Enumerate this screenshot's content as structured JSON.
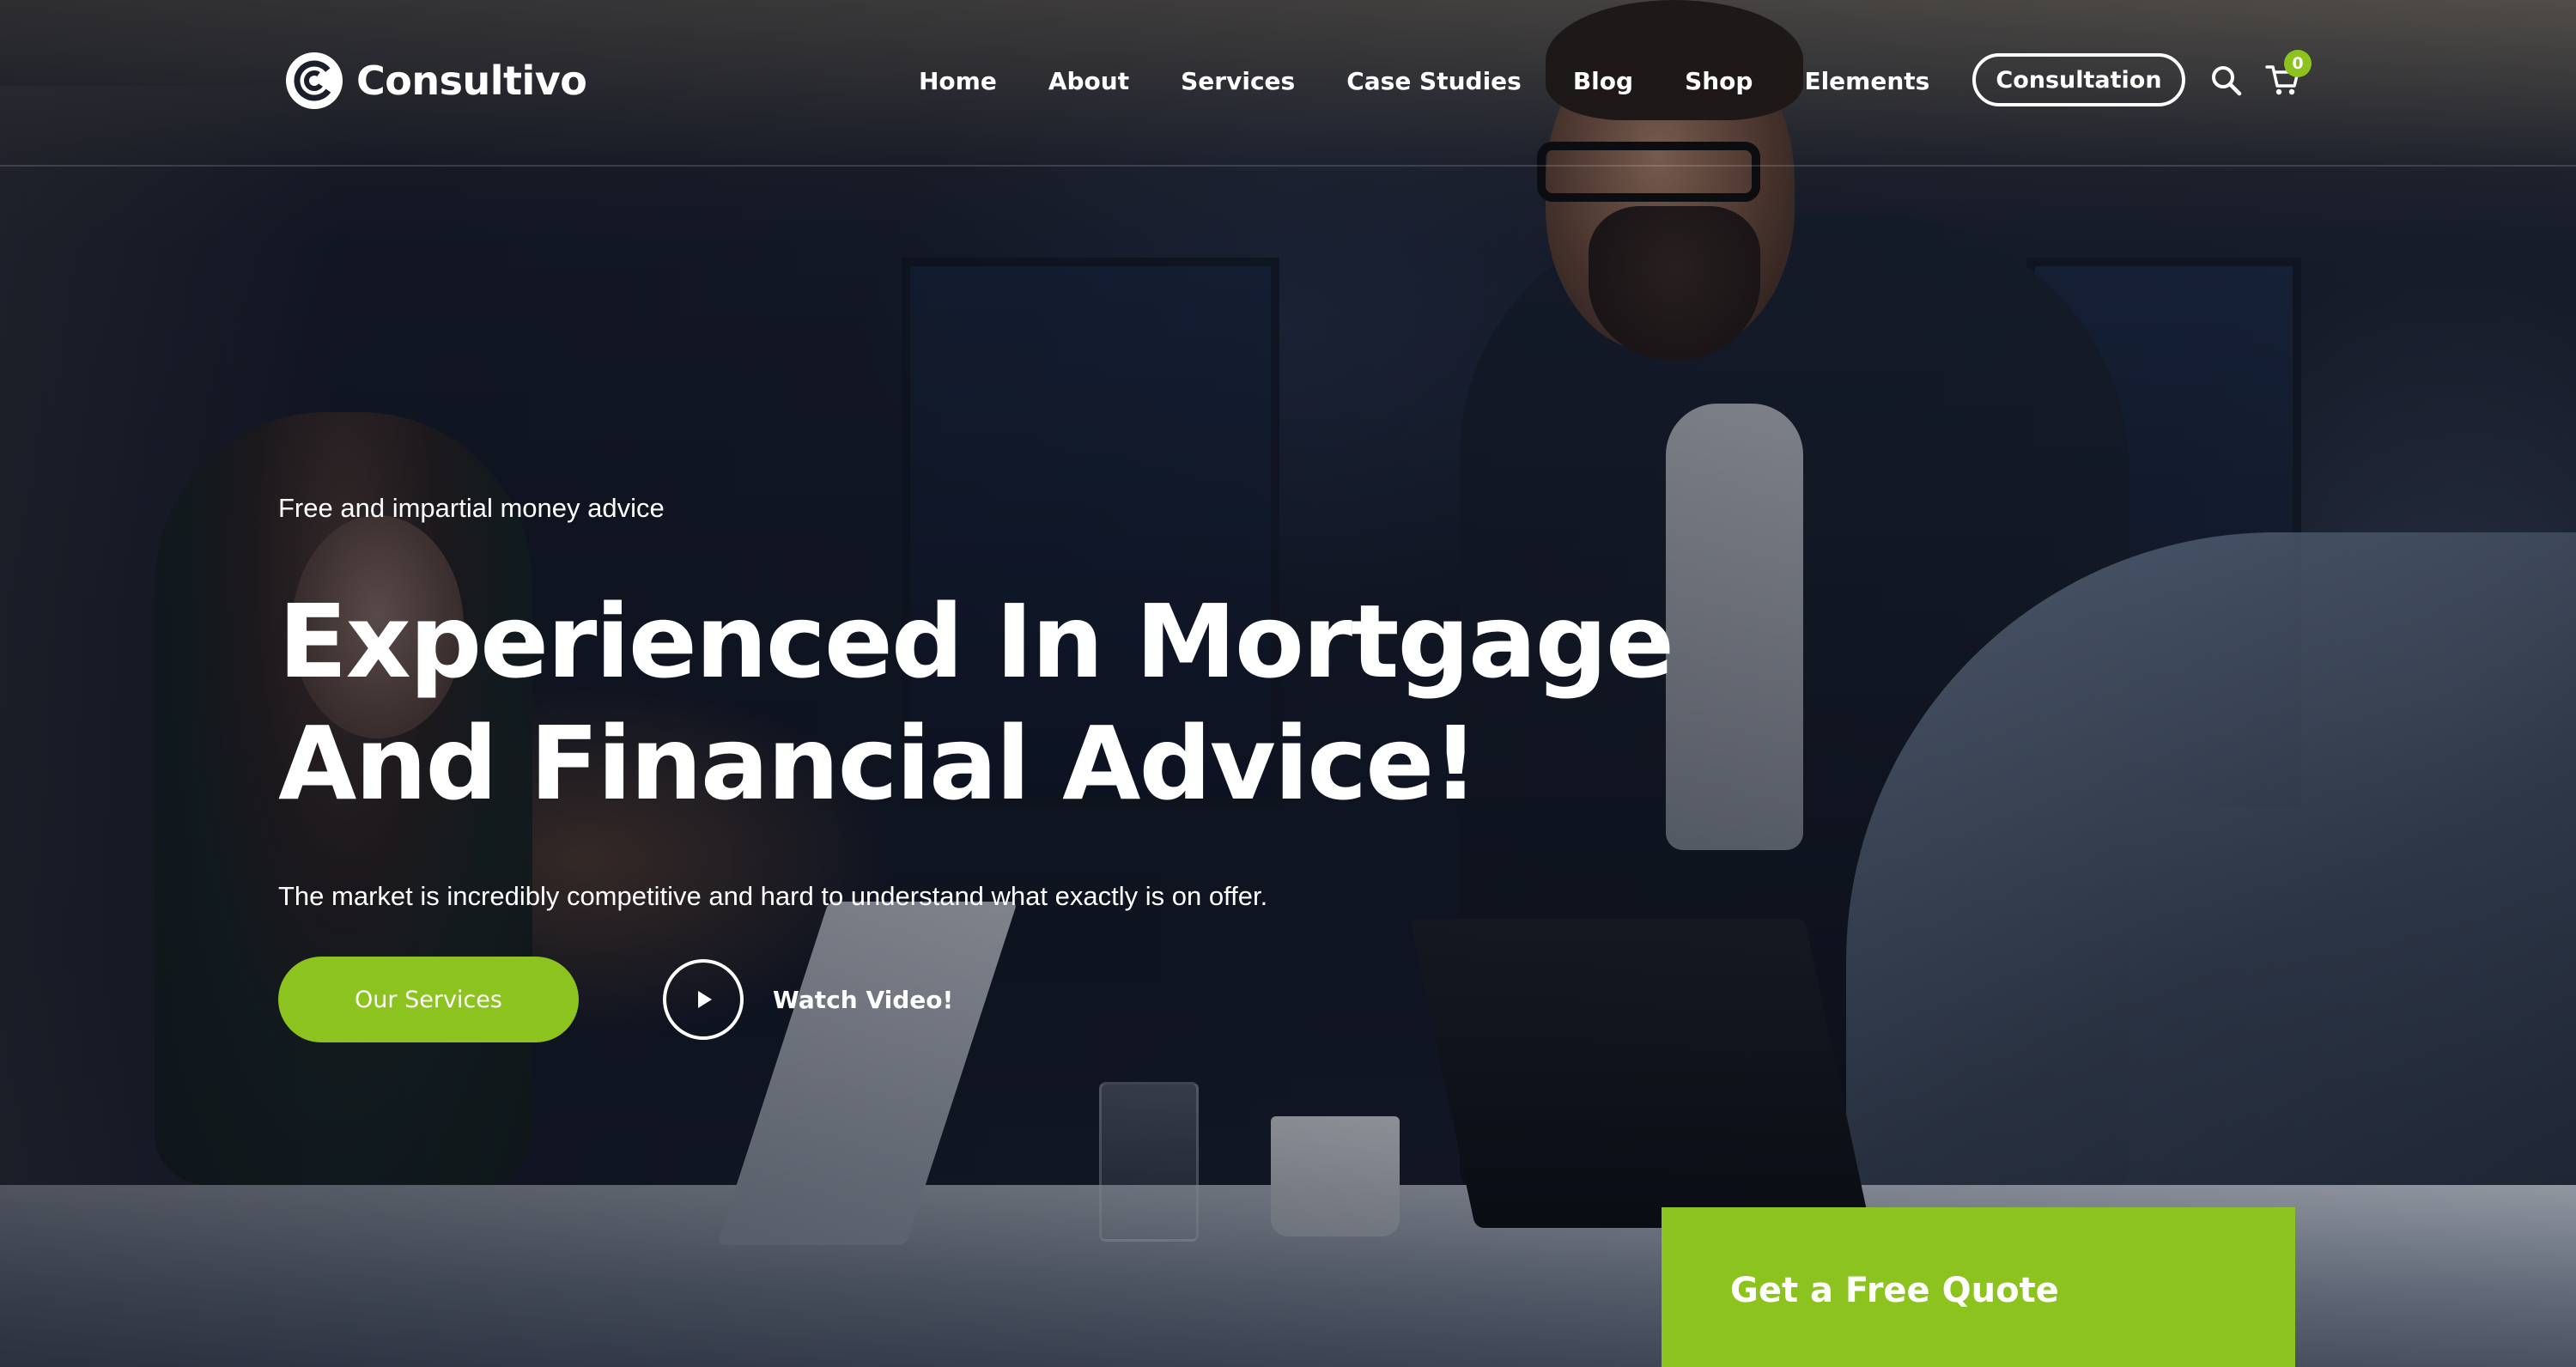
{
  "brand": {
    "name": "Consultivo",
    "logo_icon": "c-circle-icon",
    "accent_color": "#8cc31f"
  },
  "nav": {
    "items": [
      {
        "label": "Home"
      },
      {
        "label": "About"
      },
      {
        "label": "Services"
      },
      {
        "label": "Case Studies"
      },
      {
        "label": "Blog"
      },
      {
        "label": "Shop"
      },
      {
        "label": "Elements"
      }
    ],
    "cta_label": "Consultation",
    "search_icon": "search-icon",
    "cart_icon": "cart-icon",
    "cart_count": "0"
  },
  "hero": {
    "eyebrow": "Free and impartial money advice",
    "headline_line1": "Experienced In Mortgage",
    "headline_line2": "And Financial Advice!",
    "subtext": "The market is incredibly competitive and hard to understand what exactly is on offer.",
    "primary_button": "Our Services",
    "video_label": "Watch Video!",
    "video_icon": "play-icon"
  },
  "quote": {
    "title": "Get a Free Quote"
  }
}
